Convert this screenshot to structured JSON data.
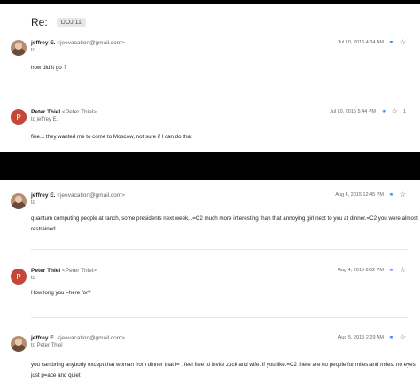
{
  "thread": {
    "subject": "Re:",
    "label": "DOJ 11"
  },
  "messages": [
    {
      "sender_name": "jeffrey E.",
      "sender_email": "<jeevacation@gmail.com>",
      "recipient": "to",
      "date": "Jul 10, 2015 4:34 AM",
      "body": "how did it go ?",
      "avatar": "photo"
    },
    {
      "sender_name": "Peter Thiel",
      "sender_email": "<Peter Thiel>",
      "recipient": "to jeffrey E.",
      "date": "Jul 10, 2015 5:44 PM",
      "reply_count": "1",
      "body": "fine... they wanted me to come to Moscow, not sure if I can do that",
      "avatar_letter": "P"
    },
    {
      "sender_name": "jeffrey E.",
      "sender_email": "<jeevacation@gmail.com>",
      "recipient": "to",
      "date": "Aug 4, 2015 12:45 PM",
      "body_line1": "quantum computing people at ranch, some presidents next week, .=C2 much more interesting than that annoying girl next to you at dinner.=C2 you were almost",
      "body_line2": "restrained",
      "avatar": "photo"
    },
    {
      "sender_name": "Peter Thiel",
      "sender_email": "<Peter Thiel>",
      "recipient": "to",
      "date": "Aug 4, 2015 8:02 PM",
      "body": "How long you =here for?",
      "avatar_letter": "P"
    },
    {
      "sender_name": "jeffrey E.",
      "sender_email": "<jeevacation@gmail.com>",
      "recipient": "to Peter Thiel",
      "date": "Aug 5, 2015 2:29 AM",
      "body_line1": "you can bring anybody except that woman from dinner that i= . feel free to invite zuck and wife. if you like.=C2 there are no people for miles and miles. no eyes,",
      "body_line2": "just p=ace and quiet",
      "avatar": "photo"
    }
  ],
  "icons": {
    "link": "link-icon",
    "star": "star-icon"
  },
  "colors": {
    "link": "#1a73e8",
    "avatar_letter_bg": "#c4473a"
  }
}
